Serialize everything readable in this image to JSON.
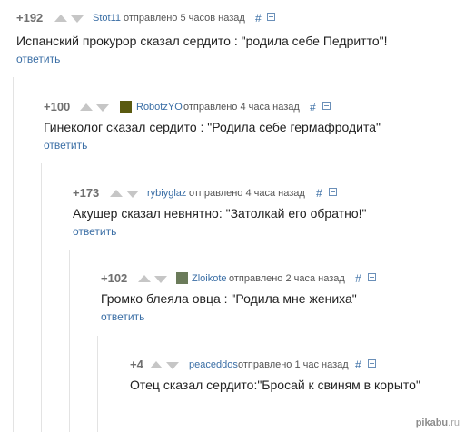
{
  "comments": [
    {
      "rating": "+192",
      "author": "Stot11",
      "posted": "отправлено 5 часов назад",
      "hash": "#",
      "text": "Испанский прокурор сказал сердито : \"родила себе Педритто\"!",
      "reply": "ответить",
      "has_avatar": false
    },
    {
      "rating": "+100",
      "author": "RobotzYO",
      "posted": "отправлено 4 часа назад",
      "hash": "#",
      "text": "Гинеколог сказал сердито : \"Родила себе гермафродита\"",
      "reply": "ответить",
      "has_avatar": true,
      "avatar_color": "#5a5a10"
    },
    {
      "rating": "+173",
      "author": "rybiyglaz",
      "posted": "отправлено 4 часа назад",
      "hash": "#",
      "text": "Акушер сказал невнятно: \"Затолкай его обратно!\"",
      "reply": "ответить",
      "has_avatar": false
    },
    {
      "rating": "+102",
      "author": "Zloikote",
      "posted": "отправлено 2 часа назад",
      "hash": "#",
      "text": "Громко блеяла овца : \"Родила мне жениха\"",
      "reply": "ответить",
      "has_avatar": true,
      "avatar_color": "#6b7b5a"
    },
    {
      "rating": "+4",
      "author": "peaceddos",
      "posted": "отправлено 1 час назад",
      "hash": "#",
      "text": "Отец сказал сердито:\"Бросай к свиням в корыто\"",
      "reply": "",
      "has_avatar": false
    }
  ],
  "watermark": {
    "brand": "pikabu",
    "suffix": ".ru"
  },
  "colors": {
    "link": "#3a6ea5",
    "rating": "#6f6f6f",
    "arrow": "#c6c6c6"
  }
}
